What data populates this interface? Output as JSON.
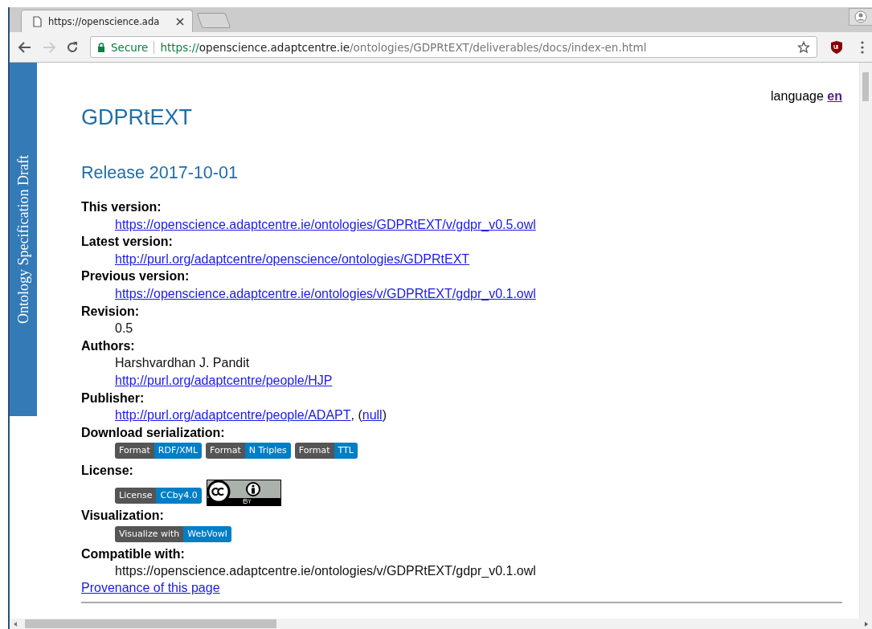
{
  "tab": {
    "title": "https://openscience.ada",
    "selected": true
  },
  "address": {
    "secure_label": "Secure",
    "scheme": "https://",
    "host": "openscience.adaptcentre.ie",
    "path": "/ontologies/GDPRtEXT/deliverables/docs/index-en.html"
  },
  "side_banner": "Ontology Specification Draft",
  "language": {
    "label": "language",
    "link": "en"
  },
  "title": "GDPRtEXT",
  "release": "Release 2017-10-01",
  "sections": [
    {
      "term": "This version:",
      "lines": [
        [
          {
            "kind": "link",
            "text": "https://openscience.adaptcentre.ie/ontologies/GDPRtEXT/v/gdpr_v0.5.owl"
          }
        ]
      ]
    },
    {
      "term": "Latest version:",
      "lines": [
        [
          {
            "kind": "link",
            "text": "http://purl.org/adaptcentre/openscience/ontologies/GDPRtEXT"
          }
        ]
      ]
    },
    {
      "term": "Previous version:",
      "lines": [
        [
          {
            "kind": "link",
            "text": "https://openscience.adaptcentre.ie/ontologies/v/GDPRtEXT/gdpr_v0.1.owl"
          }
        ]
      ]
    },
    {
      "term": "Revision:",
      "lines": [
        [
          {
            "kind": "text",
            "text": "0.5"
          }
        ]
      ]
    },
    {
      "term": "Authors:",
      "lines": [
        [
          {
            "kind": "text",
            "text": "Harshvardhan J. Pandit"
          }
        ],
        [
          {
            "kind": "link",
            "text": "http://purl.org/adaptcentre/people/HJP"
          }
        ]
      ]
    },
    {
      "term": "Publisher:",
      "lines": [
        [
          {
            "kind": "link",
            "text": "http://purl.org/adaptcentre/people/ADAPT"
          },
          {
            "kind": "text",
            "text": ", ("
          },
          {
            "kind": "link",
            "text": "null"
          },
          {
            "kind": "text",
            "text": ")"
          }
        ]
      ]
    },
    {
      "term": "Download serialization:",
      "lines": [
        [
          {
            "kind": "badge",
            "label": "Format",
            "value": "RDF/XML"
          },
          {
            "kind": "badge",
            "label": "Format",
            "value": "N Triples"
          },
          {
            "kind": "badge",
            "label": "Format",
            "value": "TTL"
          }
        ]
      ]
    },
    {
      "term": "License:",
      "lines": [
        [
          {
            "kind": "badge",
            "label": "License",
            "value": "CCby4.0"
          },
          {
            "kind": "cc-logo"
          }
        ]
      ]
    },
    {
      "term": "Visualization:",
      "lines": [
        [
          {
            "kind": "badge",
            "label": "Visualize with",
            "value": "WebVowl"
          }
        ]
      ]
    },
    {
      "term": "Compatible with:",
      "lines": [
        [
          {
            "kind": "text",
            "text": "https://openscience.adaptcentre.ie/ontologies/v/GDPRtEXT/gdpr_v0.1.owl"
          }
        ]
      ]
    }
  ],
  "provenance_link": "Provenance of this page"
}
